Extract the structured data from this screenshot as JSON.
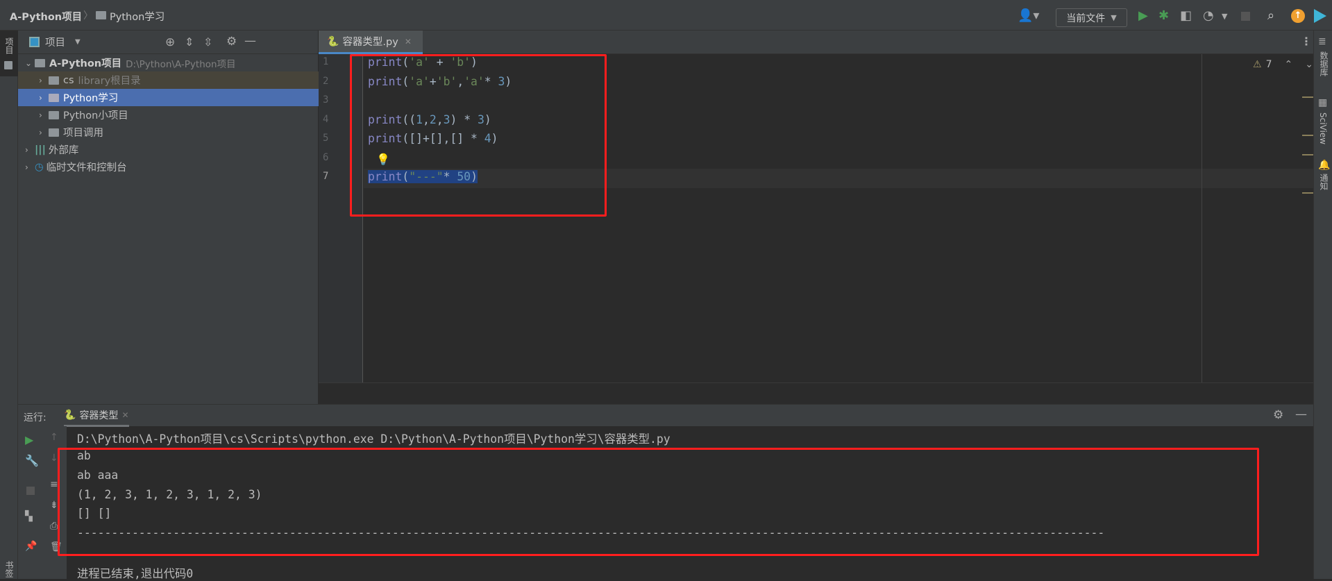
{
  "breadcrumb": {
    "project": "A-Python项目",
    "folder": "Python学习"
  },
  "toolbar": {
    "run_config": "当前文件"
  },
  "project_panel": {
    "title": "项目",
    "tree": [
      {
        "label": "A-Python项目",
        "hint": "D:\\Python\\A-Python项目"
      },
      {
        "label": "cs",
        "hint": "library根目录"
      },
      {
        "label": "Python学习"
      },
      {
        "label": "Python小项目"
      },
      {
        "label": "项目调用"
      },
      {
        "label": "外部库"
      },
      {
        "label": "临时文件和控制台"
      }
    ]
  },
  "left_strip": {
    "project_label": "项目",
    "bookmarks_label": "书签"
  },
  "editor": {
    "tab": "容器类型.py",
    "line_numbers": [
      "1",
      "2",
      "3",
      "4",
      "5",
      "6",
      "7"
    ],
    "warnings": "7",
    "lines": [
      [
        [
          "fn",
          "print"
        ],
        [
          "op",
          "("
        ],
        [
          "str",
          "'a'"
        ],
        [
          "op",
          " + "
        ],
        [
          "str",
          "'b'"
        ],
        [
          "op",
          ")"
        ]
      ],
      [
        [
          "fn",
          "print"
        ],
        [
          "op",
          "("
        ],
        [
          "str",
          "'a'"
        ],
        [
          "op",
          "+"
        ],
        [
          "str",
          "'b'"
        ],
        [
          "op",
          ","
        ],
        [
          "str",
          "'a'"
        ],
        [
          "op",
          "* "
        ],
        [
          "num",
          "3"
        ],
        [
          "op",
          ")"
        ]
      ],
      [],
      [
        [
          "fn",
          "print"
        ],
        [
          "op",
          "(("
        ],
        [
          "num",
          "1"
        ],
        [
          "op",
          ","
        ],
        [
          "num",
          "2"
        ],
        [
          "op",
          ","
        ],
        [
          "num",
          "3"
        ],
        [
          "op",
          ") * "
        ],
        [
          "num",
          "3"
        ],
        [
          "op",
          ")"
        ]
      ],
      [
        [
          "fn",
          "print"
        ],
        [
          "op",
          "([]+[],[] * "
        ],
        [
          "num",
          "4"
        ],
        [
          "op",
          ")"
        ]
      ],
      [],
      [
        [
          "fn",
          "print"
        ],
        [
          "op",
          "("
        ],
        [
          "str",
          "\"---\""
        ],
        [
          "op",
          "* "
        ],
        [
          "num",
          "50"
        ],
        [
          "op",
          ")"
        ]
      ]
    ]
  },
  "right_strip": {
    "database": "数据库",
    "sciview": "SciView",
    "notifications": "通知"
  },
  "run": {
    "label": "运行:",
    "tab": "容器类型",
    "command": "D:\\Python\\A-Python项目\\cs\\Scripts\\python.exe D:\\Python\\A-Python项目\\Python学习\\容器类型.py",
    "output": [
      "ab",
      "ab aaa",
      "(1, 2, 3, 1, 2, 3, 1, 2, 3)",
      "[] []",
      "------------------------------------------------------------------------------------------------------------------------------------------------------"
    ],
    "exit": "进程已结束,退出代码0"
  },
  "colors": {
    "accent_selection": "#4b6eaf",
    "annotation_red": "#ff1e1e",
    "run_green": "#499c54",
    "update_orange": "#f0a030"
  }
}
